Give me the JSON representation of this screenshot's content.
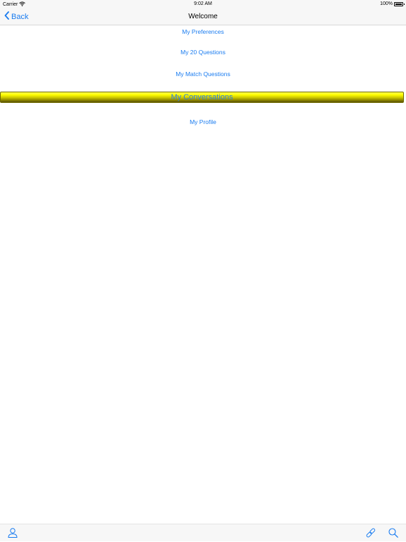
{
  "status_bar": {
    "carrier": "Carrier",
    "time": "9:02 AM",
    "battery": "100%"
  },
  "nav": {
    "back_label": "Back",
    "title": "Welcome"
  },
  "menu": {
    "preferences": "My Preferences",
    "twenty_questions": "My 20 Questions",
    "match_questions": "My Match Questions",
    "conversations": "My Conversations",
    "profile": "My Profile"
  },
  "colors": {
    "accent": "#1a7cf0",
    "highlight": "#ffff00"
  },
  "toolbar": {
    "icons": [
      "person-icon",
      "link-icon",
      "search-icon"
    ]
  }
}
